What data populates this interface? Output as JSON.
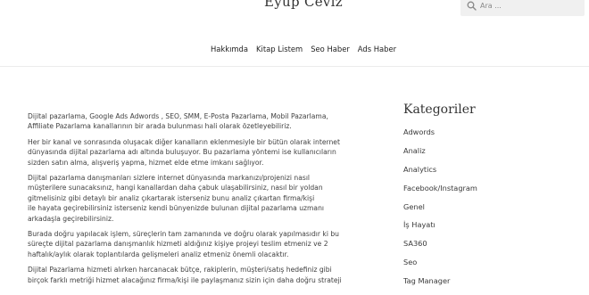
{
  "header": {
    "site_title": "Eyüp Ceviz",
    "search_placeholder": "Ara ..."
  },
  "nav": {
    "items": [
      {
        "label": "Hakkımda"
      },
      {
        "label": "Kitap Listem"
      },
      {
        "label": "Seo Haber"
      },
      {
        "label": "Ads Haber"
      }
    ]
  },
  "article": {
    "paragraphs": [
      [
        "Dijital pazarlama, Google Ads Adwords , SEO, SMM, E-Posta Pazarlama, Mobil Pazarlama,",
        "Affiliate Pazarlama kanallarının bir arada bulunması hali olarak özetleyebiliriz."
      ],
      [
        "Her bir kanal ve sonrasında oluşacak diğer kanalların eklenmesiyle bir bütün olarak internet",
        "dünyasında dijital pazarlama adı altında buluşuyor. Bu pazarlama yöntemi ise kullanıcıların",
        "sizden satın alma, alışveriş yapma, hizmet elde etme imkanı sağlıyor."
      ],
      [
        "Dijital pazarlama danışmanları sizlere internet dünyasında markanızı/projenizi nasıl",
        "müşterilere sunacaksınız, hangi kanallardan daha çabuk ulaşabilirsiniz, nasıl bir yoldan",
        "gitmelisiniz gibi detaylı bir analiz çıkartarak isterseniz bunu analiz çıkartan firma/kişi",
        "ile hayata geçirebilirsiniz isterseniz kendi bünyenizde bulunan dijital pazarlama uzmanı",
        "arkadaşla geçirebilirsiniz."
      ],
      [
        "Burada doğru yapılacak işlem, süreçlerin tam zamanında ve doğru olarak yapılmasıdır ki bu",
        "süreçte dijital pazarlama danışmanlık hizmeti aldığınız kişiye projeyi teslim etmeniz ve 2",
        "haftalık/aylık olarak toplantılarda gelişmeleri analiz etmeniz önemli olacaktır."
      ],
      [
        "Dijital Pazarlama hizmeti alırken harcanacak bütçe, rakiplerin, müşteri/satış hedefiniz gibi",
        "birçok farklı metriği hizmet alacağınız firma/kişi ile paylaşmanız sizin için daha doğru strateji"
      ]
    ]
  },
  "sidebar": {
    "title": "Kategoriler",
    "categories": [
      "Adwords",
      "Analiz",
      "Analytics",
      "Facebook/Instagram",
      "Genel",
      "İş Hayatı",
      "SA360",
      "Seo",
      "Tag Manager"
    ]
  }
}
